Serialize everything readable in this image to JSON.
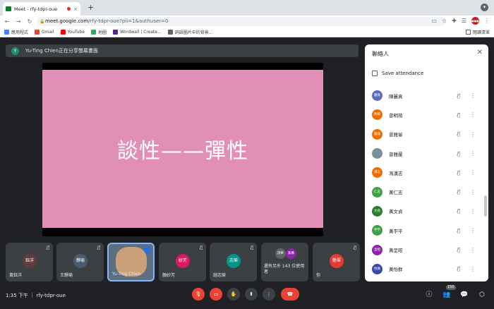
{
  "browser": {
    "tab_title": "Meet - rfy-tdpr-oue",
    "tab_close": "×",
    "new_tab": "+",
    "url_host": "meet.google.com",
    "url_path": "/rfy-tdpr-oue?pli=1&authuser=0",
    "avatar_text": "●●●",
    "window_control": "●"
  },
  "bookmarks": {
    "items": [
      {
        "label": "應用程式",
        "color": "#4285f4"
      },
      {
        "label": "Gmail",
        "color": "#ea4335"
      },
      {
        "label": "YouTube",
        "color": "#ff0000"
      },
      {
        "label": "地圖",
        "color": "#34a853"
      },
      {
        "label": "Wordwall | Create...",
        "color": "#4b2a8c"
      },
      {
        "label": "詞語圖片中的背景...",
        "color": "#5f6368"
      }
    ],
    "reading_list": "閱讀清單"
  },
  "meet": {
    "share_banner_initial": "Y",
    "share_banner_text": "Yu-Ting Chien正在分享螢幕畫面",
    "slide_text": "談性——彈性",
    "tiles": [
      {
        "name": "黃鈺洋",
        "initials": "鈺洋",
        "color": "#5f3d3a"
      },
      {
        "name": "王靜瑜",
        "initials": "靜瑜",
        "color": "#4a5b6d"
      },
      {
        "name": "Yu-Ting Chien",
        "initials": "",
        "color": "#5b6e82"
      },
      {
        "name": "顏妙芳",
        "initials": "妙芳",
        "color": "#d81b60"
      },
      {
        "name": "趙志榮",
        "initials": "志榮",
        "color": "#009688"
      },
      {
        "name": "還有另外 143 位使用者",
        "initials_a": "詩華",
        "initials_b": "家蓁",
        "color_a": "#5f6368",
        "color_b": "#8e24aa"
      },
      {
        "name": "你",
        "initials": "艷翠",
        "color": "#e53935"
      }
    ],
    "time_room": "1:35 下午 ｜ rfy-tdpr-oue",
    "participants_badge": "150"
  },
  "panel": {
    "title": "聯絡人",
    "close": "✕",
    "save_attendance": "Save attendance",
    "participants": [
      {
        "initials": "麗真",
        "name": "陳麗真",
        "color": "#5c6bc0"
      },
      {
        "initials": "明萌",
        "name": "曾明萌",
        "color": "#ef6c00"
      },
      {
        "initials": "雅瑜",
        "name": "曾雅瑜",
        "color": "#ef6c00"
      },
      {
        "initials": "",
        "name": "曾雅蘭",
        "color": "#78909c"
      },
      {
        "initials": "漢志",
        "name": "馮漢志",
        "color": "#ef6c00"
      },
      {
        "initials": "仁志",
        "name": "黃仁志",
        "color": "#43a047"
      },
      {
        "initials": "文貞",
        "name": "黃文貞",
        "color": "#2e7d32"
      },
      {
        "initials": "宇平",
        "name": "黃宇平",
        "color": "#43a047"
      },
      {
        "initials": "呈昭",
        "name": "黃呈昭",
        "color": "#8e24aa"
      },
      {
        "initials": "怡群",
        "name": "黃怡群",
        "color": "#3949ab"
      }
    ]
  }
}
